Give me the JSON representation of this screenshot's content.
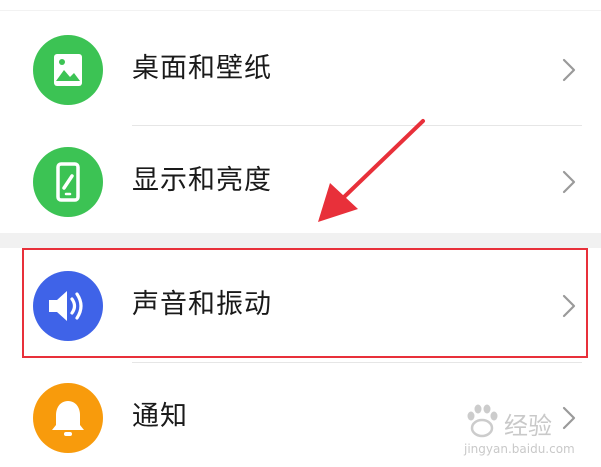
{
  "settings": {
    "items": [
      {
        "label": "桌面和壁纸",
        "icon": "wallpaper-icon",
        "icon_color": "#3cc354"
      },
      {
        "label": "显示和亮度",
        "icon": "display-brightness-icon",
        "icon_color": "#3cc354"
      },
      {
        "label": "声音和振动",
        "icon": "speaker-sound-icon",
        "icon_color": "#3f63e8"
      },
      {
        "label": "通知",
        "icon": "bell-icon",
        "icon_color": "#f89b0c"
      }
    ],
    "chevron_icon": "chevron-right-icon"
  },
  "annotation": {
    "highlight_color": "#e8303a",
    "arrow_color": "#e8303a"
  },
  "watermark": {
    "text": "经验",
    "url": "jingyan.baidu.com"
  }
}
